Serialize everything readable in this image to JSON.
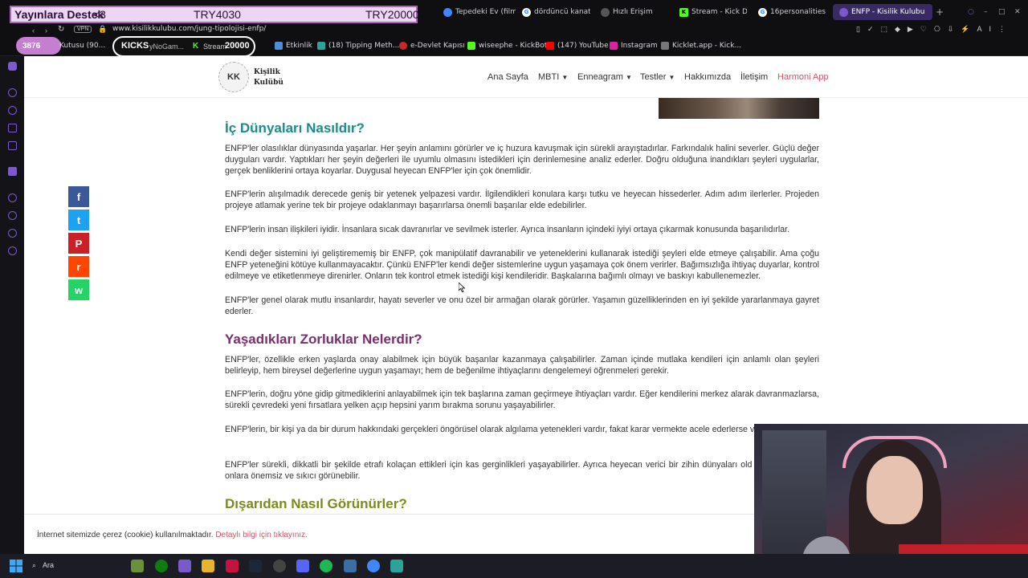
{
  "overlay": {
    "support_label": "Yayınlara Destek",
    "heart": "<3",
    "goal_current": "TRY4030",
    "goal_target": "TRY20000",
    "follower_count": "3876",
    "kicks_label": "KICKS",
    "kicks_value": "20000"
  },
  "browser": {
    "tabs": [
      {
        "label": "Tepedeki Ev (film)",
        "icon": "globe-icon",
        "color": "#4285f4"
      },
      {
        "label": "dördüncü kanat",
        "icon": "google-icon",
        "color": "#4285f4"
      },
      {
        "label": "Hızlı Erişim",
        "icon": "grid-icon",
        "color": "#666"
      },
      {
        "label": "Stream - Kick Das",
        "icon": "kick-icon",
        "color": "#53fc18"
      },
      {
        "label": "16personalities",
        "icon": "google-icon",
        "color": "#4285f4"
      },
      {
        "label": "ENFP - Kisilik Kulubu",
        "icon": "site-icon",
        "color": "#7a5ac9"
      }
    ],
    "url": "www.kisilikkulubu.com/jung-tipolojisi-enfp/",
    "vpn_label": "VPN",
    "bookmarks": [
      {
        "label": "Kutusu (90...",
        "color": "#888"
      },
      {
        "label": "yNoGam...",
        "color": "#888"
      },
      {
        "label": "Stream",
        "color": "#53fc18"
      },
      {
        "label": "Etkinlik",
        "color": "#4b8fd8"
      },
      {
        "label": "(18) Tipping Meth...",
        "color": "#2aa39a"
      },
      {
        "label": "e-Devlet Kapısı",
        "color": "#c42a2a"
      },
      {
        "label": "wiseephe - KickBot",
        "color": "#53fc18"
      },
      {
        "label": "(147) YouTube",
        "color": "#ff0000"
      },
      {
        "label": "Instagram",
        "color": "#d6249f"
      },
      {
        "label": "Kicklet.app - Kick...",
        "color": "#888"
      }
    ]
  },
  "site": {
    "logo_initials": "KK",
    "logo_line1": "Kişilik",
    "logo_line2": "Kulübü",
    "nav": [
      {
        "label": "Ana Sayfa",
        "has_caret": false
      },
      {
        "label": "MBTI",
        "has_caret": true
      },
      {
        "label": "Enneagram",
        "has_caret": true
      },
      {
        "label": "Testler",
        "has_caret": true
      },
      {
        "label": "Hakkımızda",
        "has_caret": false
      },
      {
        "label": "İletişim",
        "has_caret": false
      },
      {
        "label": "Harmoni App",
        "has_caret": false
      }
    ],
    "accent_teal": "#1f8a8a",
    "accent_purple": "#7b2d6e",
    "accent_olive": "#7d8a1a"
  },
  "article": {
    "heading_inner": "İç Dünyaları Nasıldır?",
    "p1": "ENFP'ler olasılıklar dünyasında yaşarlar. Her şeyin anlamını görürler ve iç huzura kavuşmak için sürekli arayıştadırlar. Farkındalık halini severler. Güçlü değer duyguları vardır. Yaptıkları her şeyin değerleri ile uyumlu olmasını istedikleri için derinlemesine analiz ederler. Doğru olduğuna inandıkları şeyleri uygularlar, gerçek benliklerini ortaya koyarlar. Duygusal heyecan ENFP'ler için çok önemlidir.",
    "p2": "ENFP'lerin alışılmadık derecede geniş bir yetenek yelpazesi vardır. İlgilendikleri konulara karşı tutku ve heyecan hissederler. Adım adım ilerlerler. Projeden projeye atlamak yerine tek bir projeye odaklanmayı başarırlarsa önemli başarılar elde edebilirler.",
    "p3": "ENFP'lerin insan ilişkileri iyidir. İnsanlara sıcak davranırlar ve sevilmek isterler. Ayrıca insanların içindeki iyiyi ortaya çıkarmak konusunda başarılıdırlar.",
    "p4": "Kendi değer sistemini iyi geliştirememiş bir ENFP, çok manipülatif davranabilir ve yeteneklerini kullanarak istediği şeyleri elde etmeye çalışabilir. Ama çoğu ENFP yeteneğini kötüye kullanmayacaktır. Çünkü ENFP'ler kendi değer sistemlerine uygun yaşamaya çok önem verirler. Bağımsızlığa ihtiyaç duyarlar, kontrol edilmeye ve etiketlenmeye direnirler. Onların tek kontrol etmek istediği kişi kendileridir. Başkalarına bağımlı olmayı ve baskıyı kabullenemezler.",
    "p5": "ENFP'ler genel olarak mutlu insanlardır, hayatı severler ve onu özel bir armağan olarak görürler. Yaşamın güzelliklerinden en iyi şekilde yararlanmaya gayret ederler.",
    "heading_challenges": "Yaşadıkları Zorluklar Nelerdir?",
    "p6": "ENFP'ler, özellikle erken yaşlarda onay alabilmek için büyük başarılar kazanmaya çalışabilirler. Zaman içinde mutlaka kendileri için anlamlı olan şeyleri belirleyip, hem bireysel değerlerine uygun yaşamayı; hem de beğenilme ihtiyaçlarını dengelemeyi öğrenmeleri gerekir.",
    "p7": "ENFP'lerin, doğru yöne gidip gitmediklerini anlayabilmek için tek başlarına zaman geçirmeye ihtiyaçları vardır. Eğer kendilerini merkez alarak davranmazlarsa, sürekli çevredeki yeni fırsatlara yelken açıp hepsini yarım bırakma sorunu yaşayabilirler.",
    "p8": "ENFP'lerin, bir kişi ya da bir durum hakkındaki gerçekleri öngörüsel olarak algılama yetenekleri vardır, fakat karar vermekte acele ederlerse varabilirler.",
    "p9": "ENFP'ler sürekli, dikkatli bir şekilde etrafı kolaçan ettikleri için kas gerginlikleri yaşayabilirler. Ayrıca heyecan verici bir zihin dünyaları old hayatın detayları onlara önemsiz ve sıkıcı görünebilir.",
    "heading_outside": "Dışarıdan Nasıl Görünürler?"
  },
  "share": [
    {
      "name": "facebook-icon",
      "glyph": "f",
      "color": "#3b5998"
    },
    {
      "name": "twitter-icon",
      "glyph": "t",
      "color": "#1da1f2"
    },
    {
      "name": "pinterest-icon",
      "glyph": "P",
      "color": "#cb2027"
    },
    {
      "name": "reddit-icon",
      "glyph": "r",
      "color": "#ff4500"
    },
    {
      "name": "whatsapp-icon",
      "glyph": "w",
      "color": "#25d366"
    }
  ],
  "cookie": {
    "text": "İnternet sitemizde çerez (cookie) kullanılmaktadır.",
    "link": "Detaylı bilgi için tıklayınız."
  },
  "taskbar": {
    "search_label": "Ara"
  }
}
